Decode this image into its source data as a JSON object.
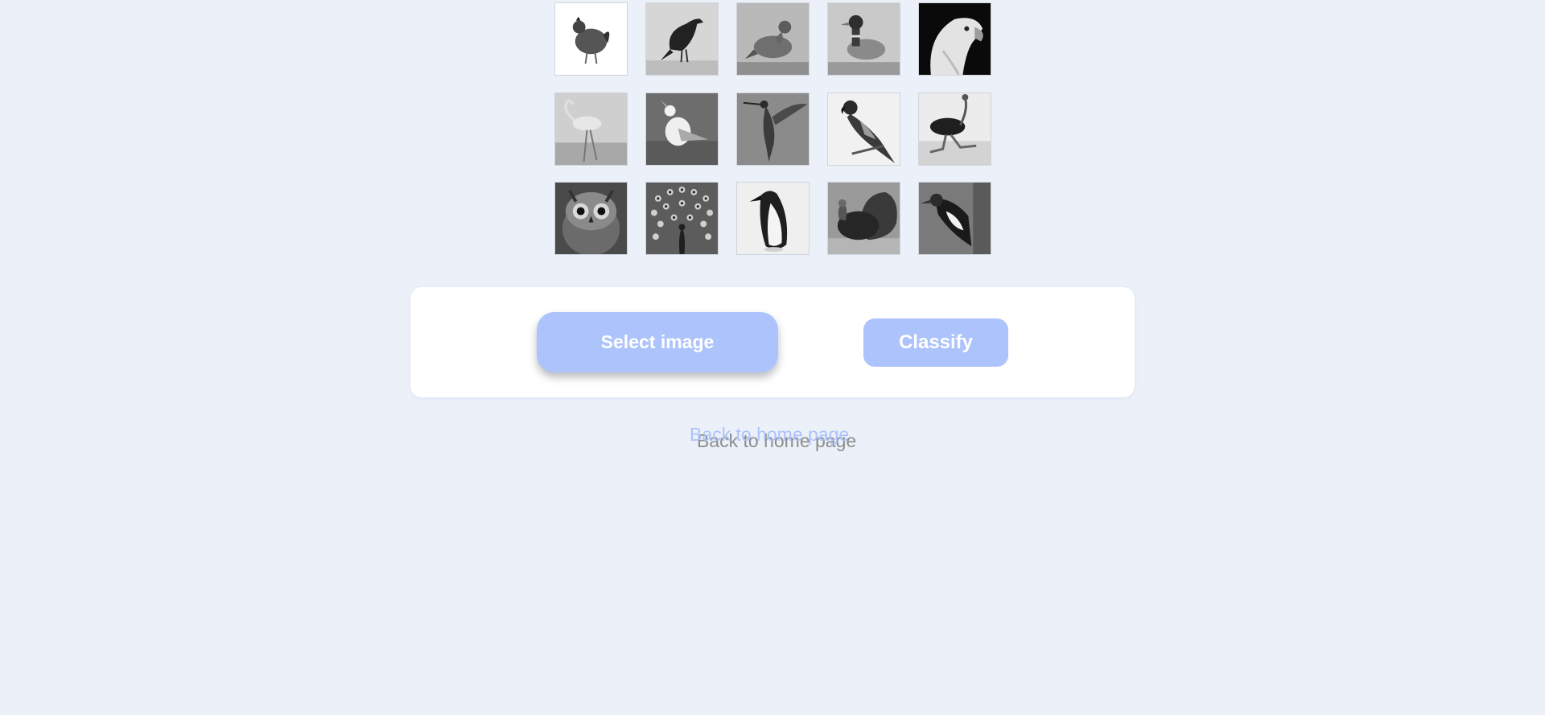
{
  "gallery": {
    "rows": [
      [
        {
          "name": "chicken",
          "icon": "chicken-image"
        },
        {
          "name": "crow",
          "icon": "crow-image"
        },
        {
          "name": "pigeon",
          "icon": "pigeon-image"
        },
        {
          "name": "duck",
          "icon": "duck-image"
        },
        {
          "name": "eagle",
          "icon": "eagle-image"
        }
      ],
      [
        {
          "name": "flamingo",
          "icon": "flamingo-image"
        },
        {
          "name": "seagull",
          "icon": "seagull-image"
        },
        {
          "name": "hummingbird",
          "icon": "hummingbird-image"
        },
        {
          "name": "parrot",
          "icon": "parrot-image"
        },
        {
          "name": "ostrich",
          "icon": "ostrich-image"
        }
      ],
      [
        {
          "name": "owl",
          "icon": "owl-image"
        },
        {
          "name": "peacock",
          "icon": "peacock-image"
        },
        {
          "name": "penguin",
          "icon": "penguin-image"
        },
        {
          "name": "turkey",
          "icon": "turkey-image"
        },
        {
          "name": "woodpecker",
          "icon": "woodpecker-image"
        }
      ]
    ]
  },
  "actions": {
    "select_label": "Select image",
    "classify_label": "Classify"
  },
  "footer": {
    "back_label": "Back to home page",
    "back_shadow_label": "Back to home page"
  },
  "colors": {
    "background": "#ebf0f9",
    "accent": "#adc3fb",
    "card": "#ffffff"
  }
}
